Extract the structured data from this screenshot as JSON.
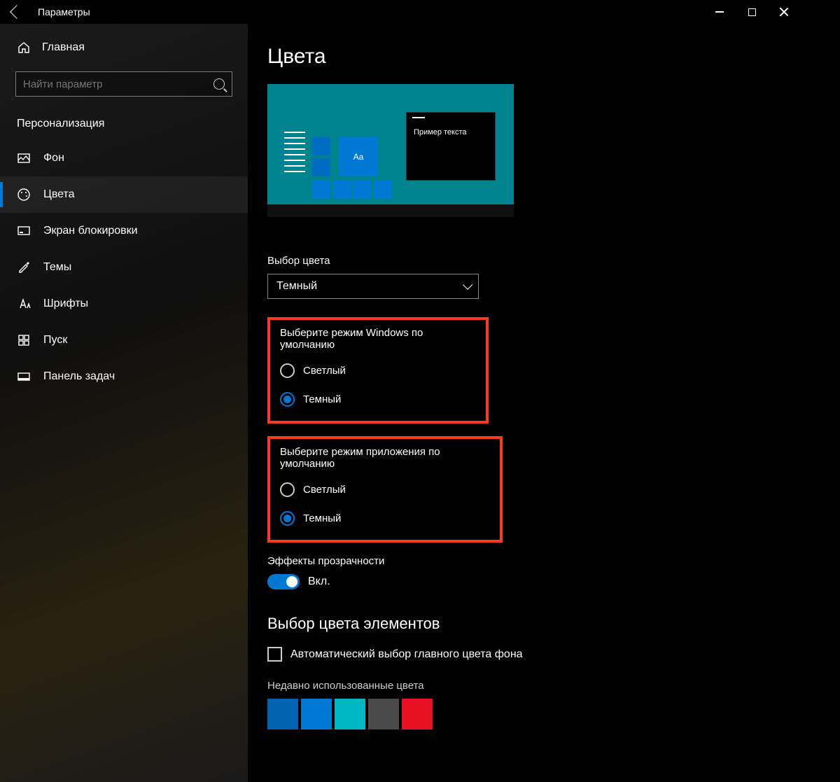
{
  "window": {
    "title": "Параметры"
  },
  "sidebar": {
    "home_label": "Главная",
    "search_placeholder": "Найти параметр",
    "section_label": "Персонализация",
    "items": [
      {
        "label": "Фон"
      },
      {
        "label": "Цвета"
      },
      {
        "label": "Экран блокировки"
      },
      {
        "label": "Темы"
      },
      {
        "label": "Шрифты"
      },
      {
        "label": "Пуск"
      },
      {
        "label": "Панель задач"
      }
    ]
  },
  "main": {
    "page_title": "Цвета",
    "preview_sample_text": "Пример текста",
    "preview_tile_text": "Aa",
    "choose_color_label": "Выбор цвета",
    "choose_color_value": "Темный",
    "groups": [
      {
        "title": "Выберите режим Windows по умолчанию",
        "options": [
          {
            "label": "Светлый",
            "checked": false
          },
          {
            "label": "Темный",
            "checked": true
          }
        ]
      },
      {
        "title": "Выберите режим приложения по умолчанию",
        "options": [
          {
            "label": "Светлый",
            "checked": false
          },
          {
            "label": "Темный",
            "checked": true
          }
        ]
      }
    ],
    "transparency_label": "Эффекты прозрачности",
    "transparency_state": "Вкл.",
    "accent_heading": "Выбор цвета элементов",
    "auto_pick_label": "Автоматический выбор главного цвета фона",
    "recent_colors_label": "Недавно использованные цвета",
    "recent_colors": [
      "#0063b1",
      "#0078d4",
      "#00b7c3",
      "#4a4a4a",
      "#e81123"
    ]
  }
}
